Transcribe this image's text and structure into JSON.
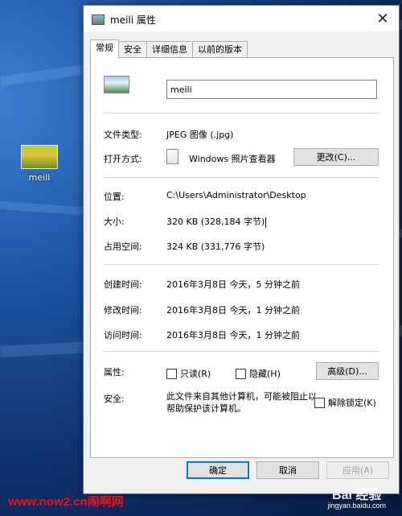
{
  "desktop": {
    "icon_label": "meili",
    "watermark_left": "www.now2.cn闹啊网",
    "watermark_brand": "Bai 经验",
    "watermark_url": "jingyan.baidu.com"
  },
  "dialog": {
    "title": "meili 属性",
    "tabs": [
      {
        "label": "常规",
        "active": true
      },
      {
        "label": "安全",
        "active": false
      },
      {
        "label": "详细信息",
        "active": false
      },
      {
        "label": "以前的版本",
        "active": false
      }
    ],
    "file_name": "meili",
    "file_type": {
      "label": "文件类型:",
      "value": "JPEG 图像 (.jpg)"
    },
    "opens_with": {
      "label": "打开方式:",
      "value": "Windows 照片查看器",
      "button": "更改(C)..."
    },
    "location": {
      "label": "位置:",
      "value": "C:\\Users\\Administrator\\Desktop"
    },
    "size": {
      "label": "大小:",
      "value": "320 KB (328,184 字节)"
    },
    "size_on_disk": {
      "label": "占用空间:",
      "value": "324 KB (331,776 字节)"
    },
    "created": {
      "label": "创建时间:",
      "value": "2016年3月8日 今天，5 分钟之前"
    },
    "modified": {
      "label": "修改时间:",
      "value": "2016年3月8日 今天，1 分钟之前"
    },
    "accessed": {
      "label": "访问时间:",
      "value": "2016年3月8日 今天，1 分钟之前"
    },
    "attributes": {
      "label": "属性:",
      "readonly": {
        "label": "只读(R)",
        "checked": false
      },
      "hidden": {
        "label": "隐藏(H)",
        "checked": false
      },
      "advanced_button": "高级(D)..."
    },
    "security": {
      "label": "安全:",
      "text": "此文件来自其他计算机，可能被阻止以帮助保护该计算机。",
      "unblock": {
        "label": "解除锁定(K)",
        "checked": false
      }
    },
    "buttons": {
      "ok": "确定",
      "cancel": "取消",
      "apply": "应用(A)"
    },
    "colors": {
      "accent": "#0078d7",
      "panel": "#ffffff",
      "chrome": "#f0f0f0"
    }
  }
}
